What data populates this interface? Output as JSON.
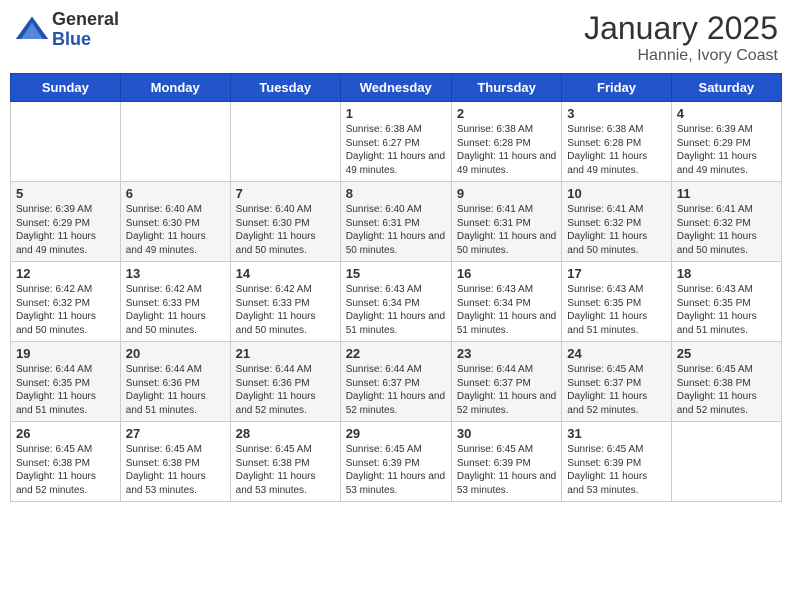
{
  "header": {
    "logo_general": "General",
    "logo_blue": "Blue",
    "month_title": "January 2025",
    "location": "Hannie, Ivory Coast"
  },
  "days_of_week": [
    "Sunday",
    "Monday",
    "Tuesday",
    "Wednesday",
    "Thursday",
    "Friday",
    "Saturday"
  ],
  "weeks": [
    [
      {
        "day": "",
        "info": ""
      },
      {
        "day": "",
        "info": ""
      },
      {
        "day": "",
        "info": ""
      },
      {
        "day": "1",
        "info": "Sunrise: 6:38 AM\nSunset: 6:27 PM\nDaylight: 11 hours and 49 minutes."
      },
      {
        "day": "2",
        "info": "Sunrise: 6:38 AM\nSunset: 6:28 PM\nDaylight: 11 hours and 49 minutes."
      },
      {
        "day": "3",
        "info": "Sunrise: 6:38 AM\nSunset: 6:28 PM\nDaylight: 11 hours and 49 minutes."
      },
      {
        "day": "4",
        "info": "Sunrise: 6:39 AM\nSunset: 6:29 PM\nDaylight: 11 hours and 49 minutes."
      }
    ],
    [
      {
        "day": "5",
        "info": "Sunrise: 6:39 AM\nSunset: 6:29 PM\nDaylight: 11 hours and 49 minutes."
      },
      {
        "day": "6",
        "info": "Sunrise: 6:40 AM\nSunset: 6:30 PM\nDaylight: 11 hours and 49 minutes."
      },
      {
        "day": "7",
        "info": "Sunrise: 6:40 AM\nSunset: 6:30 PM\nDaylight: 11 hours and 50 minutes."
      },
      {
        "day": "8",
        "info": "Sunrise: 6:40 AM\nSunset: 6:31 PM\nDaylight: 11 hours and 50 minutes."
      },
      {
        "day": "9",
        "info": "Sunrise: 6:41 AM\nSunset: 6:31 PM\nDaylight: 11 hours and 50 minutes."
      },
      {
        "day": "10",
        "info": "Sunrise: 6:41 AM\nSunset: 6:32 PM\nDaylight: 11 hours and 50 minutes."
      },
      {
        "day": "11",
        "info": "Sunrise: 6:41 AM\nSunset: 6:32 PM\nDaylight: 11 hours and 50 minutes."
      }
    ],
    [
      {
        "day": "12",
        "info": "Sunrise: 6:42 AM\nSunset: 6:32 PM\nDaylight: 11 hours and 50 minutes."
      },
      {
        "day": "13",
        "info": "Sunrise: 6:42 AM\nSunset: 6:33 PM\nDaylight: 11 hours and 50 minutes."
      },
      {
        "day": "14",
        "info": "Sunrise: 6:42 AM\nSunset: 6:33 PM\nDaylight: 11 hours and 50 minutes."
      },
      {
        "day": "15",
        "info": "Sunrise: 6:43 AM\nSunset: 6:34 PM\nDaylight: 11 hours and 51 minutes."
      },
      {
        "day": "16",
        "info": "Sunrise: 6:43 AM\nSunset: 6:34 PM\nDaylight: 11 hours and 51 minutes."
      },
      {
        "day": "17",
        "info": "Sunrise: 6:43 AM\nSunset: 6:35 PM\nDaylight: 11 hours and 51 minutes."
      },
      {
        "day": "18",
        "info": "Sunrise: 6:43 AM\nSunset: 6:35 PM\nDaylight: 11 hours and 51 minutes."
      }
    ],
    [
      {
        "day": "19",
        "info": "Sunrise: 6:44 AM\nSunset: 6:35 PM\nDaylight: 11 hours and 51 minutes."
      },
      {
        "day": "20",
        "info": "Sunrise: 6:44 AM\nSunset: 6:36 PM\nDaylight: 11 hours and 51 minutes."
      },
      {
        "day": "21",
        "info": "Sunrise: 6:44 AM\nSunset: 6:36 PM\nDaylight: 11 hours and 52 minutes."
      },
      {
        "day": "22",
        "info": "Sunrise: 6:44 AM\nSunset: 6:37 PM\nDaylight: 11 hours and 52 minutes."
      },
      {
        "day": "23",
        "info": "Sunrise: 6:44 AM\nSunset: 6:37 PM\nDaylight: 11 hours and 52 minutes."
      },
      {
        "day": "24",
        "info": "Sunrise: 6:45 AM\nSunset: 6:37 PM\nDaylight: 11 hours and 52 minutes."
      },
      {
        "day": "25",
        "info": "Sunrise: 6:45 AM\nSunset: 6:38 PM\nDaylight: 11 hours and 52 minutes."
      }
    ],
    [
      {
        "day": "26",
        "info": "Sunrise: 6:45 AM\nSunset: 6:38 PM\nDaylight: 11 hours and 52 minutes."
      },
      {
        "day": "27",
        "info": "Sunrise: 6:45 AM\nSunset: 6:38 PM\nDaylight: 11 hours and 53 minutes."
      },
      {
        "day": "28",
        "info": "Sunrise: 6:45 AM\nSunset: 6:38 PM\nDaylight: 11 hours and 53 minutes."
      },
      {
        "day": "29",
        "info": "Sunrise: 6:45 AM\nSunset: 6:39 PM\nDaylight: 11 hours and 53 minutes."
      },
      {
        "day": "30",
        "info": "Sunrise: 6:45 AM\nSunset: 6:39 PM\nDaylight: 11 hours and 53 minutes."
      },
      {
        "day": "31",
        "info": "Sunrise: 6:45 AM\nSunset: 6:39 PM\nDaylight: 11 hours and 53 minutes."
      },
      {
        "day": "",
        "info": ""
      }
    ]
  ]
}
